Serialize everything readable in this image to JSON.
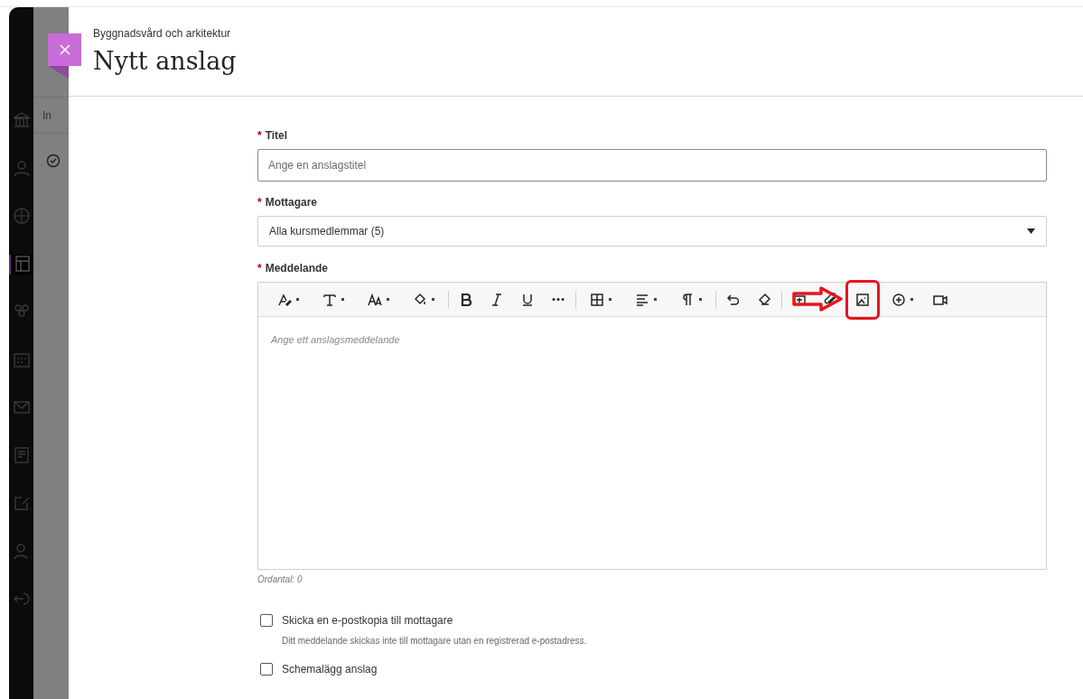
{
  "background_page": {
    "tab_label": "In",
    "nav": [
      {
        "selected": false
      },
      {
        "selected": false
      },
      {
        "selected": false
      },
      {
        "selected": true
      },
      {
        "selected": false
      },
      {
        "selected": false
      },
      {
        "selected": false
      },
      {
        "selected": false
      },
      {
        "selected": false
      },
      {
        "selected": false
      },
      {
        "selected": false
      }
    ]
  },
  "panel": {
    "breadcrumb": "Byggnadsvård och arkitektur",
    "title": "Nytt anslag"
  },
  "form": {
    "title_field": {
      "label": "Titel",
      "required_mark": "*",
      "placeholder": "Ange en anslagstitel"
    },
    "recipients": {
      "label": "Mottagare",
      "required_mark": "*",
      "value": "Alla kursmedlemmar (5)"
    },
    "message": {
      "label": "Meddelande",
      "required_mark": "*",
      "placeholder": "Ange ett anslagsmeddelande",
      "word_count": "Ordantal: 0",
      "toolbar": [
        {
          "kind": "tool",
          "dropdown": true
        },
        {
          "kind": "tool",
          "dropdown": true
        },
        {
          "kind": "tool",
          "dropdown": true
        },
        {
          "kind": "tool",
          "dropdown": true
        },
        {
          "kind": "separator"
        },
        {
          "kind": "tool",
          "dropdown": false
        },
        {
          "kind": "tool",
          "dropdown": false
        },
        {
          "kind": "tool",
          "dropdown": false
        },
        {
          "kind": "tool",
          "dropdown": false
        },
        {
          "kind": "separator"
        },
        {
          "kind": "tool",
          "dropdown": true
        },
        {
          "kind": "tool",
          "dropdown": true
        },
        {
          "kind": "tool",
          "dropdown": true
        },
        {
          "kind": "separator"
        },
        {
          "kind": "tool",
          "dropdown": false
        },
        {
          "kind": "tool",
          "dropdown": false
        },
        {
          "kind": "separator"
        },
        {
          "kind": "tool",
          "dropdown": false
        },
        {
          "kind": "tool",
          "dropdown": false
        },
        {
          "kind": "tool",
          "dropdown": false,
          "highlighted": true
        },
        {
          "kind": "tool",
          "dropdown": true
        },
        {
          "kind": "tool",
          "dropdown": false
        }
      ]
    },
    "options": [
      {
        "label": "Skicka en e-postkopia till mottagare",
        "checked": false,
        "hint": "Ditt meddelande skickas inte till mottagare utan en registrerad e-postadress."
      },
      {
        "label": "Schemalägg anslag",
        "checked": false
      }
    ]
  }
}
